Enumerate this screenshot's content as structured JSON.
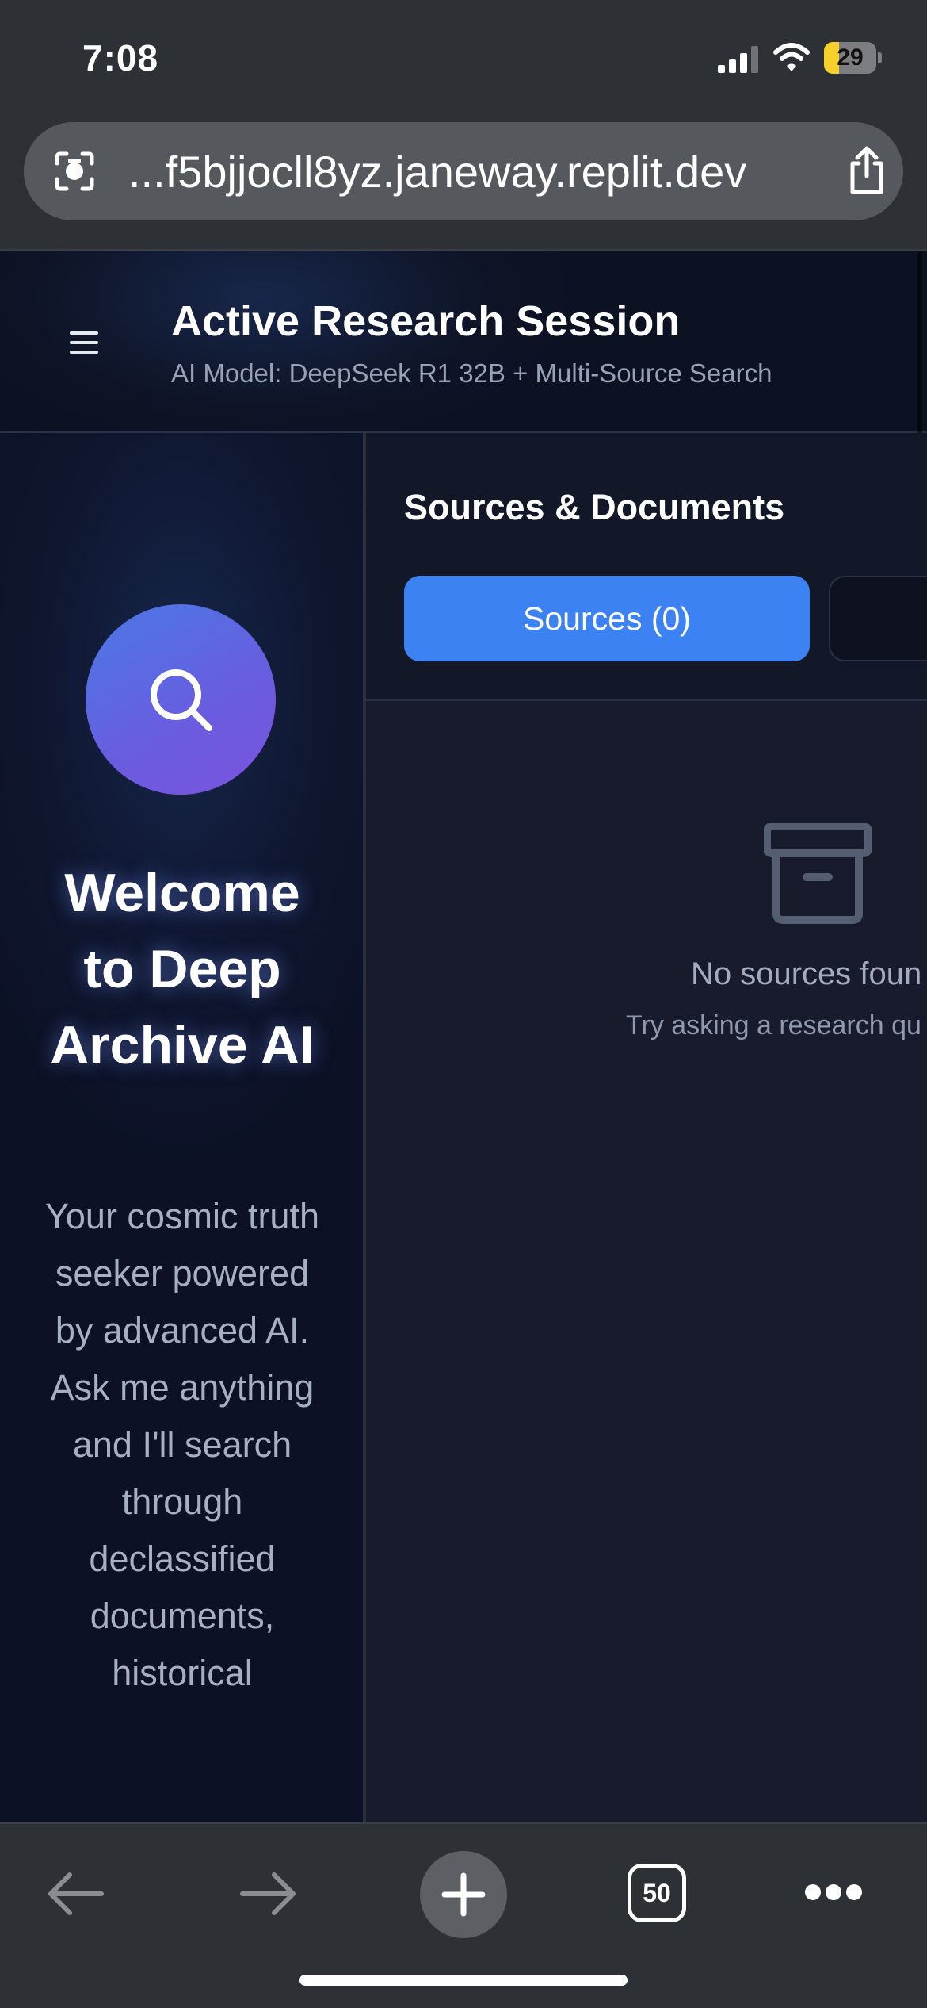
{
  "status_bar": {
    "time": "7:08",
    "battery_level": "29",
    "battery_fraction": 0.29,
    "icons": [
      "signal-icon",
      "wifi-icon",
      "battery-icon"
    ]
  },
  "browser": {
    "url": "...f5bjjocll8yz.janeway.replit.dev",
    "tabs_count": "50",
    "icons": [
      "lens-icon",
      "share-icon",
      "back-arrow-icon",
      "forward-arrow-icon",
      "plus-icon",
      "more-icon"
    ]
  },
  "header": {
    "title": "Active Research Session",
    "subtitle": "AI Model: DeepSeek R1 32B + Multi-Source Search"
  },
  "welcome": {
    "title": "Welcome to Deep Archive AI",
    "description": "Your cosmic truth seeker powered by advanced AI. Ask me anything and I'll search through declassified documents, historical"
  },
  "sources_panel": {
    "title": "Sources & Documents",
    "tabs": [
      {
        "label": "Sources (0)",
        "active": true
      }
    ],
    "empty_state": {
      "title": "No sources foun",
      "subtitle": "Try asking a research qu"
    }
  },
  "colors": {
    "accent": "#3c82f2",
    "avatar_gradient_start": "#4a79e6",
    "avatar_gradient_end": "#7a54de",
    "panel_bg": "#171b2c",
    "battery": "#f7d02c"
  }
}
